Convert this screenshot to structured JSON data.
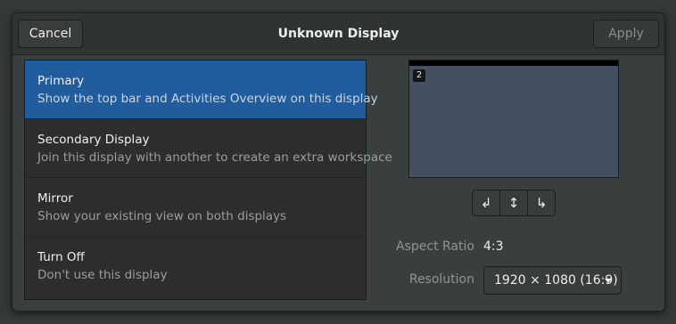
{
  "header": {
    "cancel_label": "Cancel",
    "title": "Unknown Display",
    "apply_label": "Apply"
  },
  "modes": [
    {
      "title": "Primary",
      "subtitle": "Show the top bar and Activities Overview on this display",
      "selected": true
    },
    {
      "title": "Secondary Display",
      "subtitle": "Join this display with another to create an extra workspace",
      "selected": false
    },
    {
      "title": "Mirror",
      "subtitle": "Show your existing view on both displays",
      "selected": false
    },
    {
      "title": "Turn Off",
      "subtitle": "Don't use this display",
      "selected": false
    }
  ],
  "preview": {
    "display_number": "2"
  },
  "rotation": {
    "buttons": [
      {
        "icon": "rotate-left-icon",
        "glyph": "↲"
      },
      {
        "icon": "flip-vertical-icon",
        "glyph": "↕"
      },
      {
        "icon": "rotate-right-icon",
        "glyph": "↳"
      }
    ]
  },
  "settings": {
    "aspect_ratio_label": "Aspect Ratio",
    "aspect_ratio_value": "4:3",
    "resolution_label": "Resolution",
    "resolution_value": "1920 × 1080 (16:9)"
  },
  "colors": {
    "selected_row": "#215d9c",
    "preview_screen": "#445062"
  }
}
